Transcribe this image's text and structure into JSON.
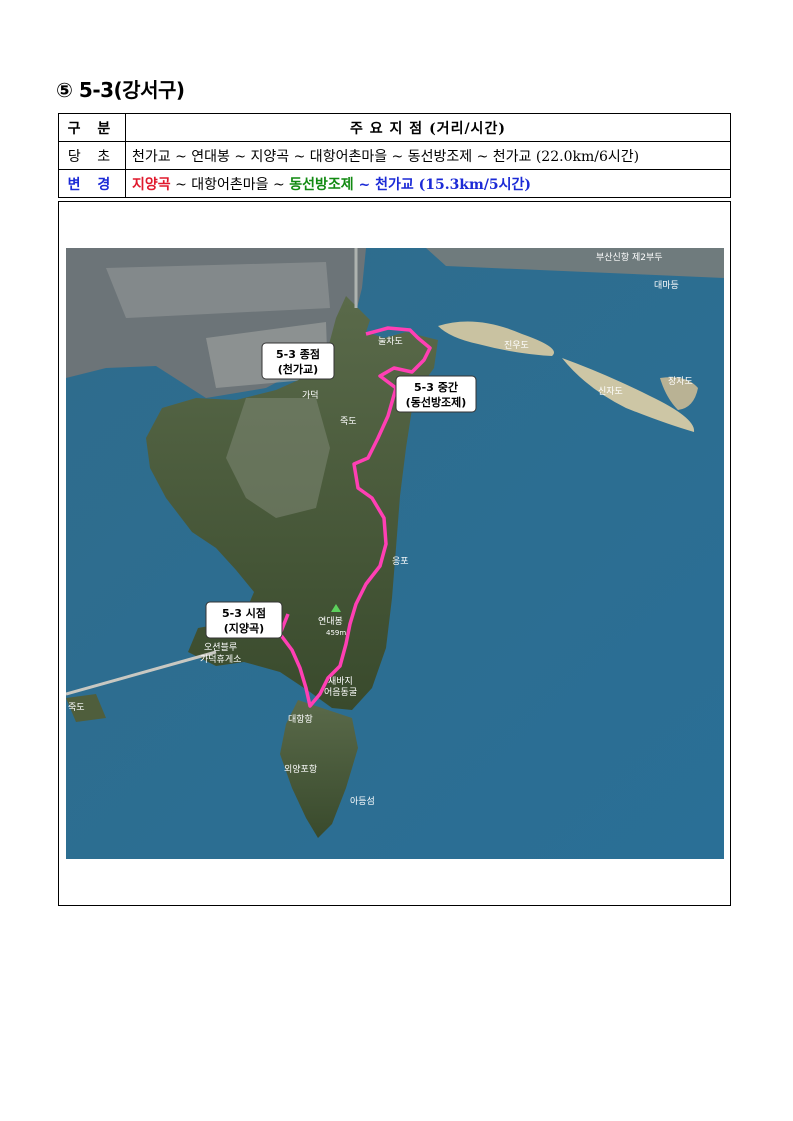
{
  "heading": "⑤ 5-3(강서구)",
  "table": {
    "header": {
      "col1": "구 분",
      "col2": "주 요 지 점 (거리/시간)"
    },
    "rows": [
      {
        "label": "당 초",
        "route": "천가교 ~ 연대봉 ~ 지양곡 ~ 대항어촌마을 ~ 동선방조제 ~ 천가교 (22.0km/6시간)"
      },
      {
        "label": "변 경",
        "seg1": "지양곡",
        "sep1": " ~ 대항어촌마을 ~ ",
        "seg2": "동선방조제",
        "seg3": " ~ 천가교 (15.3km/5시간)"
      }
    ]
  },
  "map": {
    "callouts": {
      "end": {
        "line1": "5-3 종점",
        "line2": "(천가교)"
      },
      "mid": {
        "line1": "5-3 중간",
        "line2": "(동선방조제)"
      },
      "start": {
        "line1": "5-3 시점",
        "line2": "(지양곡)"
      }
    },
    "places": {
      "jinudo": "진우도",
      "sinjado": "신자도",
      "jangjado": "장자도",
      "daemadeung": "대마등",
      "jukdo": "죽도",
      "gadeok": "가덕",
      "nulcha": "눌차도",
      "eumpo": "응포",
      "yeondaebong": "연대봉",
      "yeondaebong_height": "459m",
      "rest1": "오션블루",
      "rest2": "가덕휴게소",
      "saebaji": "새바지",
      "cave": "어음동굴",
      "daehang": "대항항",
      "oeyangpo": "외양포항",
      "adeungseom": "아등섬",
      "jukdo_left": "죽도",
      "topright": "부산신항 제2부두"
    },
    "colors": {
      "sea": "#2e6f92",
      "land": "#4c5f3a",
      "route": "#ff3fb4"
    }
  }
}
